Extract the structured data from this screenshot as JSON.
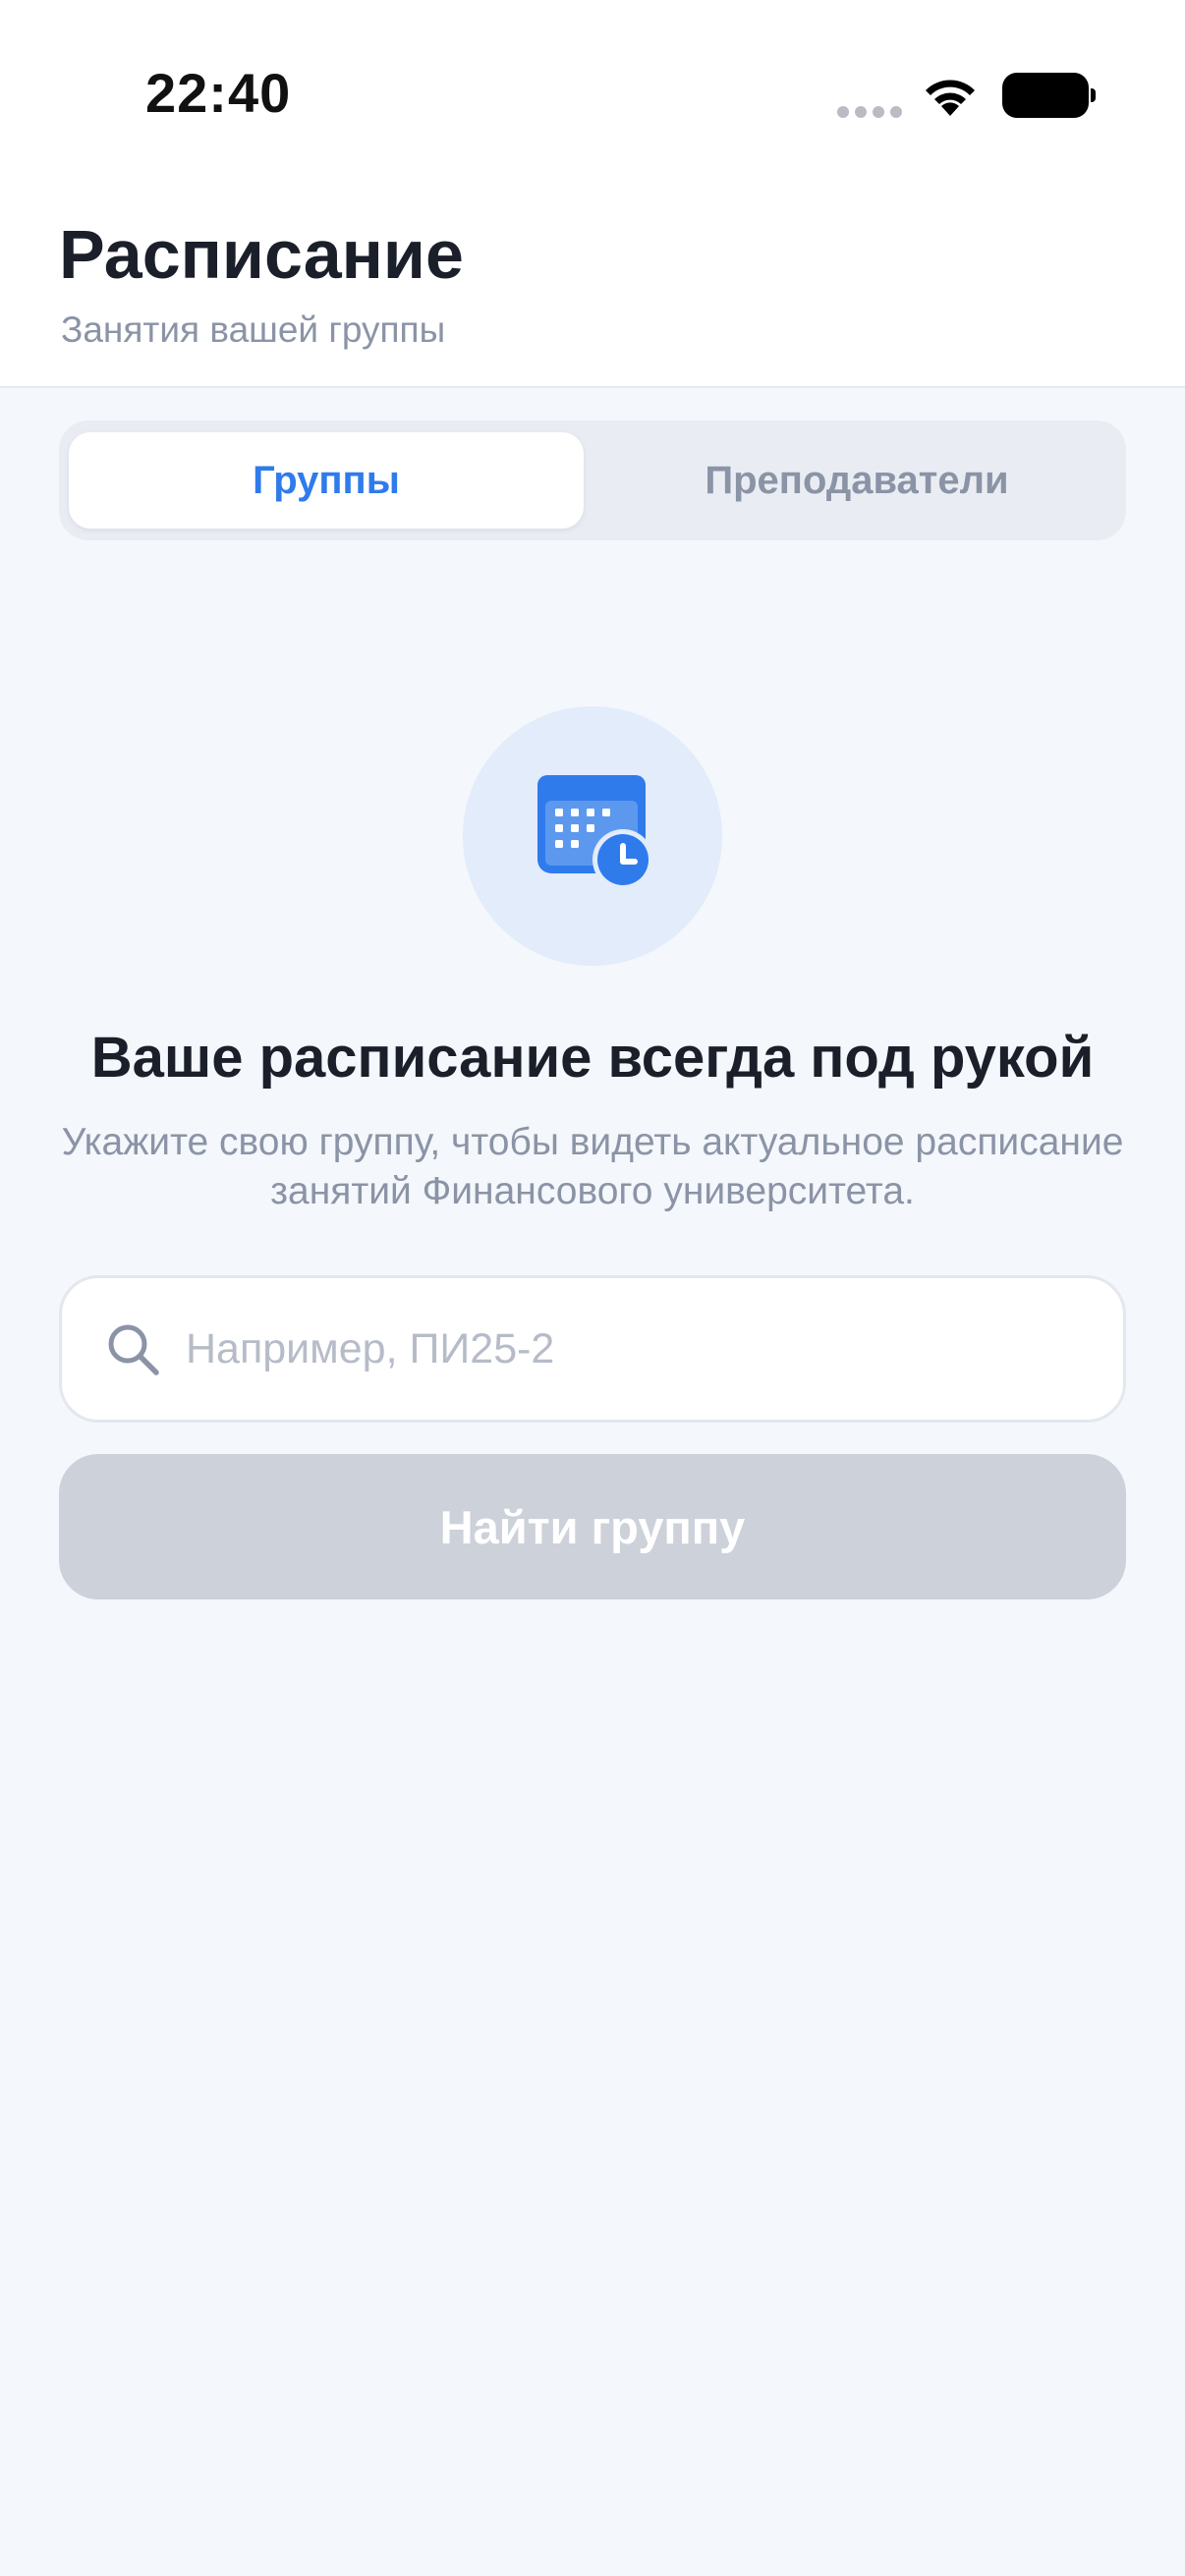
{
  "status_bar": {
    "time": "22:40"
  },
  "header": {
    "title": "Расписание",
    "subtitle": "Занятия вашей группы"
  },
  "tabs": [
    {
      "label": "Группы",
      "active": true
    },
    {
      "label": "Преподаватели",
      "active": false
    }
  ],
  "empty_state": {
    "icon": "calendar-clock-icon",
    "title": "Ваше расписание всегда под рукой",
    "description": "Укажите свою группу, чтобы видеть актуальное расписание занятий Финансового университета."
  },
  "search": {
    "placeholder": "Например, ПИ25-2",
    "value": ""
  },
  "find_button": {
    "label": "Найти группу"
  },
  "colors": {
    "accent": "#2f7bec",
    "background": "#f4f7fb",
    "button_disabled": "#cdd1d9",
    "icon_circle": "#e2ecfa"
  }
}
